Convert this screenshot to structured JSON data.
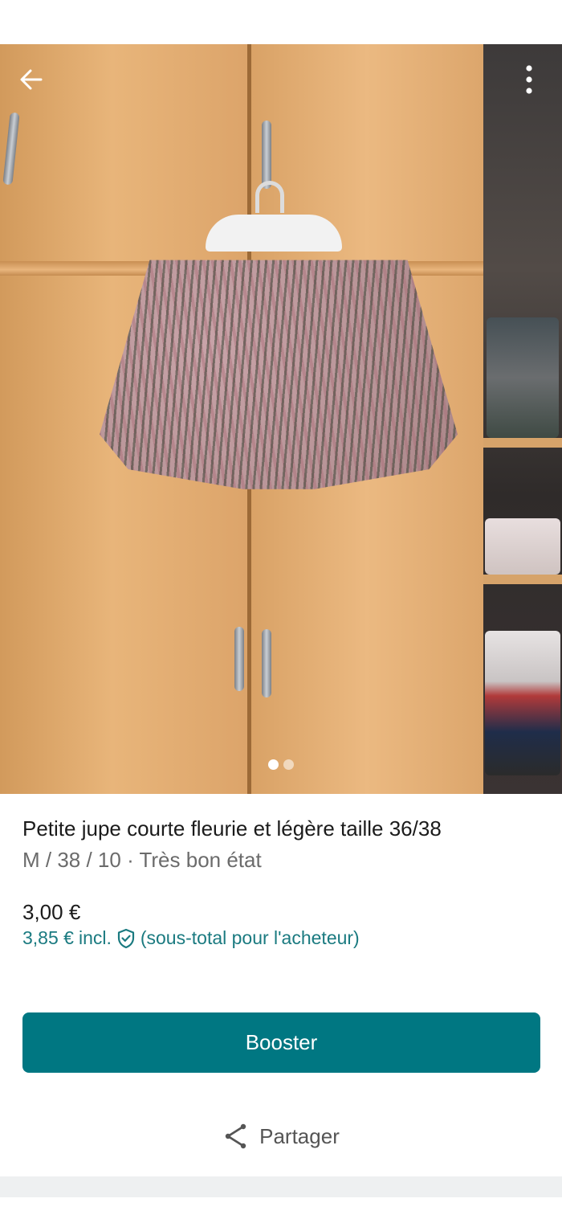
{
  "header": {
    "back_icon": "arrow-left-icon",
    "more_icon": "more-vertical-icon"
  },
  "gallery": {
    "image_count": 2,
    "active_index": 0
  },
  "item": {
    "title": "Petite jupe courte fleurie et légère taille 36/38",
    "details": "M / 38 / 10 · Très bon état",
    "price": "3,00 €",
    "buyer_price": "3,85 €",
    "buyer_incl": "incl.",
    "buyer_note": "(sous-total pour l'acheteur)",
    "protection_icon": "shield-check-icon"
  },
  "actions": {
    "booster_label": "Booster",
    "share_label": "Partager",
    "share_icon": "share-icon"
  },
  "colors": {
    "accent": "#007782",
    "buyer_text": "#1a7a80",
    "title_text": "#1b1b1b",
    "subtitle_text": "#6b6b6b"
  }
}
